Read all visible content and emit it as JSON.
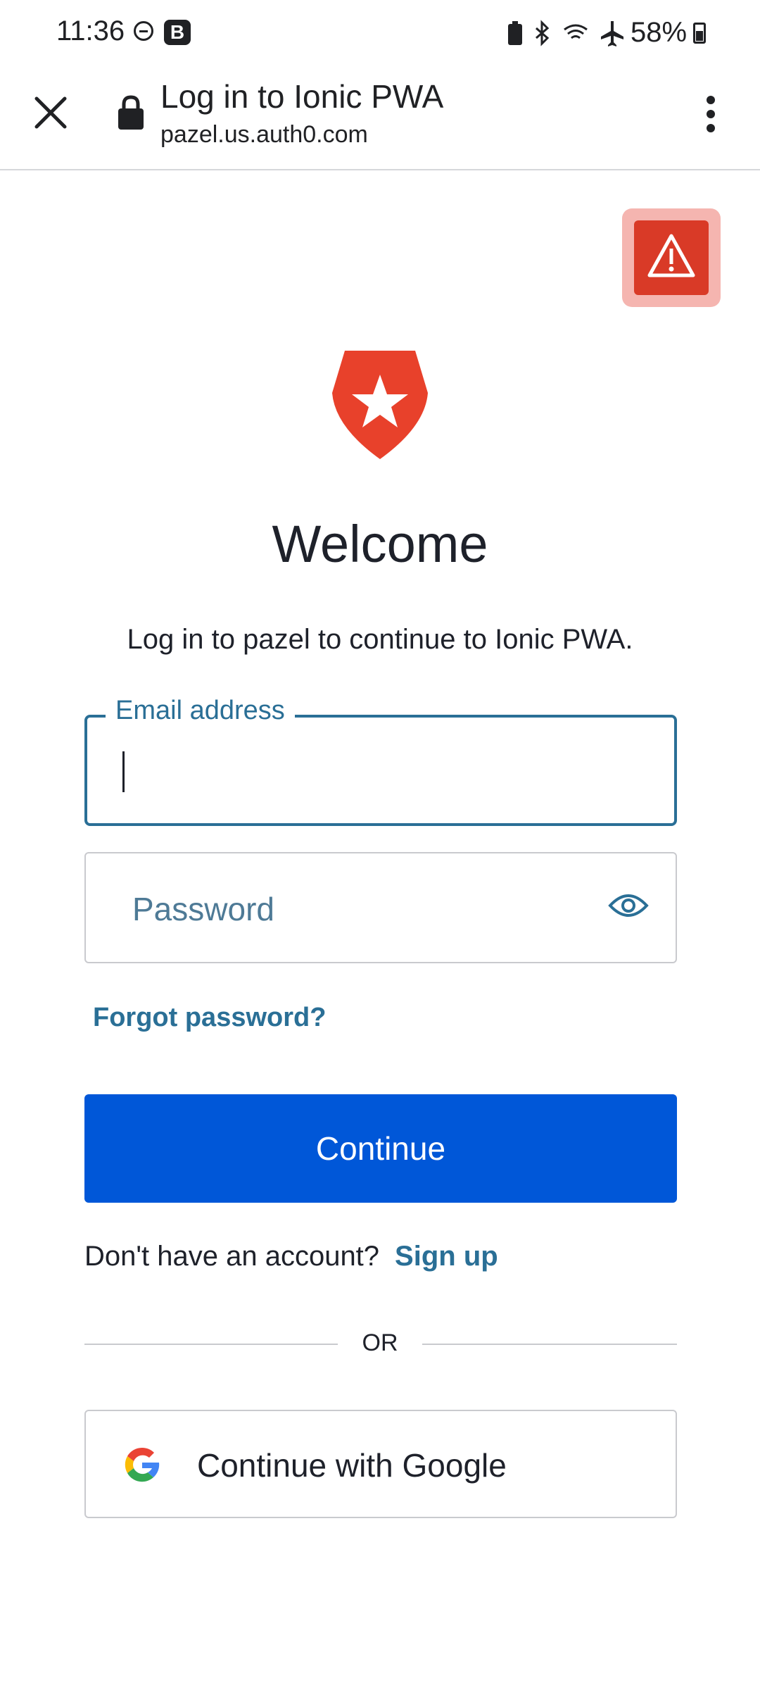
{
  "status_bar": {
    "time": "11:36",
    "badge": "B",
    "battery_percent": "58%"
  },
  "toolbar": {
    "title": "Log in to Ionic PWA",
    "url": "pazel.us.auth0.com"
  },
  "login": {
    "heading": "Welcome",
    "subtitle": "Log in to pazel to continue to Ionic PWA.",
    "email_label": "Email address",
    "email_value": "",
    "password_placeholder": "Password",
    "forgot_link": "Forgot password?",
    "continue_button": "Continue",
    "no_account_text": "Don't have an account?",
    "signup_link": "Sign up",
    "divider_text": "OR",
    "google_button": "Continue with Google"
  },
  "colors": {
    "primary_button": "#0057d8",
    "link": "#2a6f96",
    "brand_red": "#d93a27",
    "warning_highlight": "#f5b5b0"
  },
  "icons": [
    "close-icon",
    "lock-icon",
    "more-vert-icon",
    "warning-icon",
    "auth0-logo",
    "eye-icon",
    "google-icon"
  ]
}
